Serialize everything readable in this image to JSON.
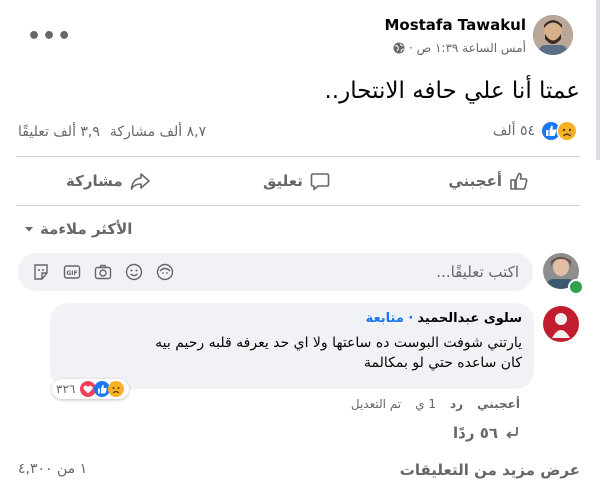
{
  "post": {
    "author": "Mostafa Tawakul",
    "time": "أمس الساعة ١:٣٩ ص ·",
    "privacy_icon": "globe-icon",
    "text": "عمتا أنا علي حافه الانتحار..",
    "reactions_count": "٥٤ ألف",
    "comments_count": "٣,٩ ألف تعليقًا",
    "shares_count": "٨,٧ ألف مشاركة",
    "reaction_icons": [
      "sad-reaction-icon",
      "like-reaction-icon"
    ]
  },
  "actions": {
    "like": "أعجبني",
    "comment": "تعليق",
    "share": "مشاركة"
  },
  "sort": {
    "label": "الأكثر ملاءمة"
  },
  "composer": {
    "placeholder": "اكتب تعليقًا...",
    "icons": [
      "sticker-icon",
      "gif-icon",
      "camera-icon",
      "emoji-icon",
      "avatar-sticker-icon"
    ]
  },
  "comment": {
    "author": "سلوى عبدالحميد",
    "follow": "· متابعة",
    "line1": "يارتني شوفت البوست ده ساعتها ولا اي حد يعرفه قلبه رحيم بيه",
    "line2": "كان ساعده حتي لو بمكالمة",
    "reactions_count": "٣٢٦",
    "like": "أعجبني",
    "reply": "رد",
    "time": "1 ي",
    "edited": "تم التعديل"
  },
  "replies": {
    "label": "٥٦ ردًا"
  },
  "footer": {
    "more_comments": "عرض مزيد من التعليقات",
    "count": "١ من ٤,٣٠٠"
  },
  "colors": {
    "like_blue": "#1877f2",
    "sad_yellow": "#f7b125",
    "love_red": "#f33e58",
    "text_muted": "#65676b"
  }
}
